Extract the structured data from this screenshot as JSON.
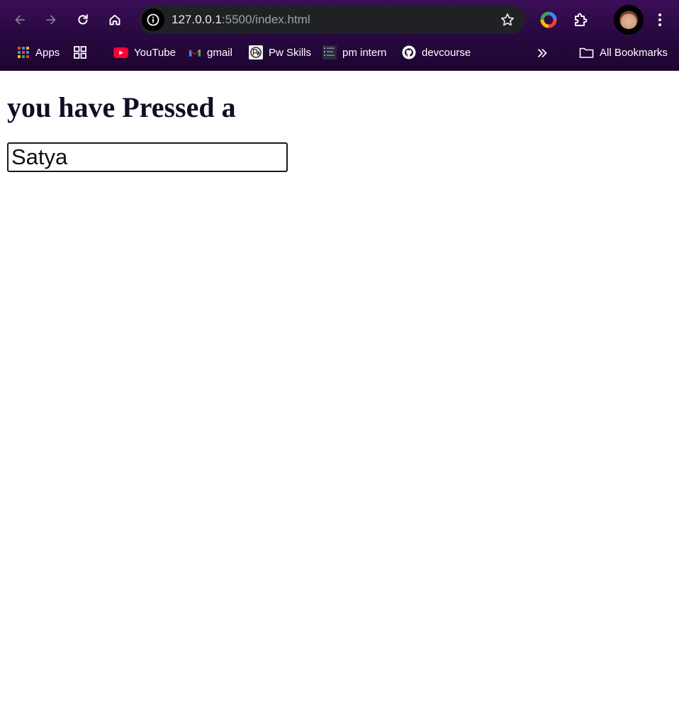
{
  "browser": {
    "url_host": "127.0.0.1",
    "url_rest": ":5500/index.html",
    "icons": {
      "back": "arrow-left-icon",
      "forward": "arrow-right-icon",
      "reload": "reload-icon",
      "home": "home-icon",
      "site_info": "info-icon",
      "bookmark_star": "star-icon",
      "extension_color": "color-wheel-icon",
      "extensions": "puzzle-icon",
      "profile": "avatar",
      "menu": "three-dots-icon"
    },
    "colors": {
      "frame_top": "#3a0e57",
      "frame_bottom": "#1c0530",
      "omnibox": "#202124"
    }
  },
  "bookmarks": {
    "items": [
      {
        "label": "Apps",
        "icon": "apps-grid-icon"
      },
      {
        "label": "",
        "icon": "tab-groups-icon"
      },
      {
        "label": "YouTube",
        "icon": "youtube-icon"
      },
      {
        "label": "gmail",
        "icon": "gmail-icon"
      },
      {
        "label": "Pw Skills",
        "icon": "pw-skills-icon"
      },
      {
        "label": "pm intern",
        "icon": "list-icon"
      },
      {
        "label": "devcourse",
        "icon": "github-icon"
      }
    ],
    "more_icon": "double-chevron-right-icon",
    "all_bookmarks": {
      "label": "All Bookmarks",
      "icon": "folder-icon"
    }
  },
  "page": {
    "heading": "you have Pressed a",
    "input_value": "Satya"
  }
}
